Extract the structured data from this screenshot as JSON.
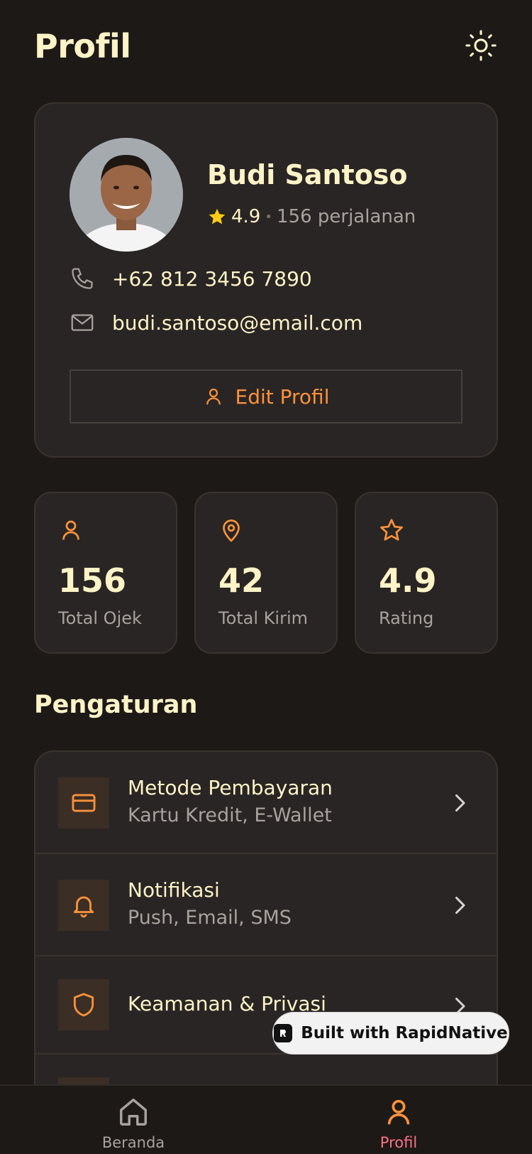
{
  "header": {
    "title": "Profil",
    "theme_icon": "sun-icon"
  },
  "profile": {
    "name": "Budi Santoso",
    "rating": "4.9",
    "separator": "•",
    "trips": "156 perjalanan",
    "phone": "+62 812 3456 7890",
    "email": "budi.santoso@email.com",
    "edit_label": "Edit Profil"
  },
  "stats": [
    {
      "icon": "user-icon",
      "value": "156",
      "label": "Total Ojek"
    },
    {
      "icon": "map-pin-icon",
      "value": "42",
      "label": "Total Kirim"
    },
    {
      "icon": "star-icon",
      "value": "4.9",
      "label": "Rating"
    }
  ],
  "settings": {
    "title": "Pengaturan",
    "items": [
      {
        "icon": "credit-card-icon",
        "title": "Metode Pembayaran",
        "subtitle": "Kartu Kredit, E-Wallet"
      },
      {
        "icon": "bell-icon",
        "title": "Notifikasi",
        "subtitle": "Push, Email, SMS"
      },
      {
        "icon": "shield-icon",
        "title": "Keamanan & Privasi",
        "subtitle": ""
      }
    ]
  },
  "badge": {
    "label": "Built with RapidNative"
  },
  "tabs": [
    {
      "icon": "home-icon",
      "label": "Beranda",
      "active": false
    },
    {
      "icon": "user-icon",
      "label": "Profil",
      "active": true
    }
  ],
  "colors": {
    "accent": "#fb923c",
    "background": "#1c1917",
    "card": "#292524",
    "text": "#fef3c7",
    "muted": "#a8a29e",
    "star": "#facc15",
    "active_tab_label": "#fb7185"
  }
}
